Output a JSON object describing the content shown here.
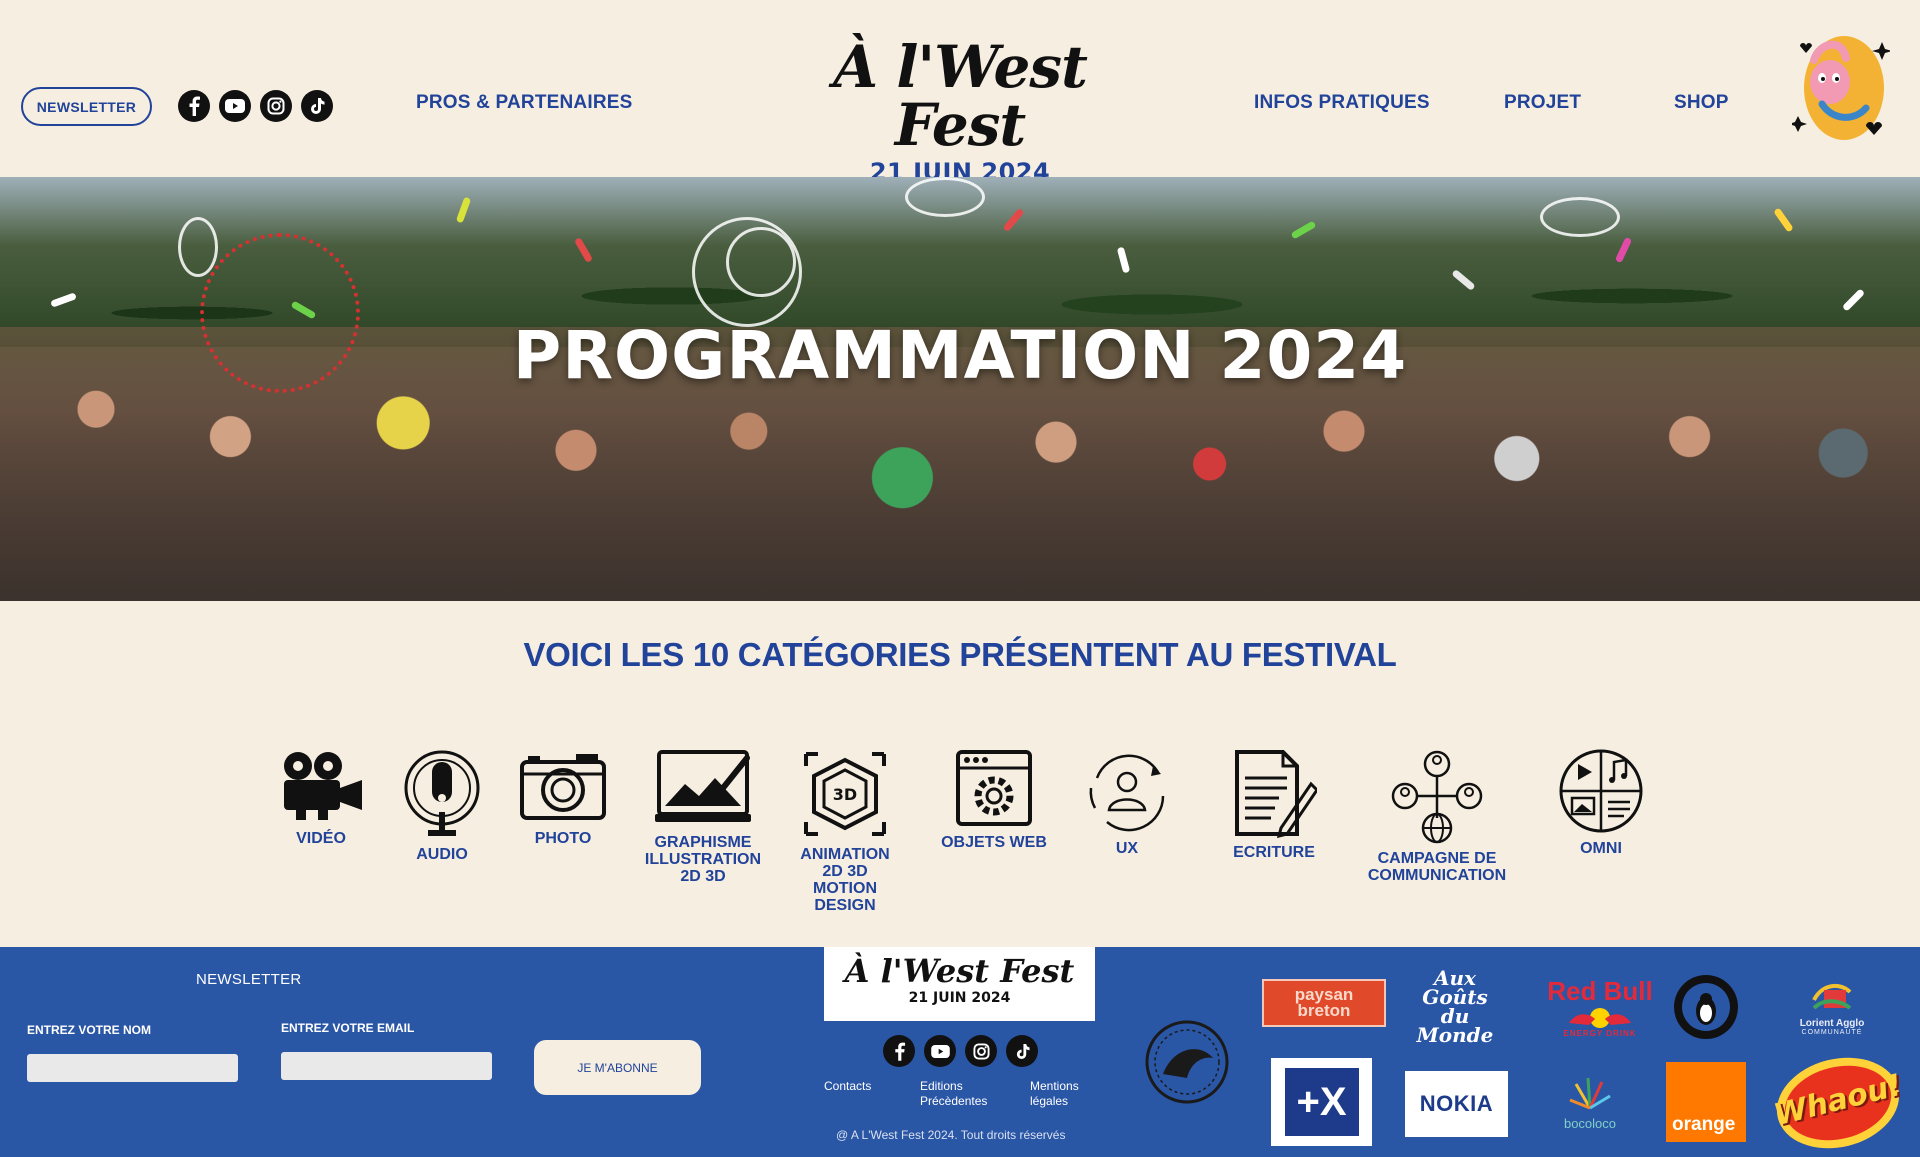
{
  "header": {
    "newsletter_label": "NEWSLETTER",
    "socials": [
      "facebook-icon",
      "youtube-icon",
      "instagram-icon",
      "tiktok-icon"
    ],
    "nav_left": "PROS & PARTENAIRES",
    "brand_title": "À l'West Fest",
    "brand_date": "21 JUIN 2024",
    "nav_right": [
      "INFOS PRATIQUES",
      "PROJET",
      "SHOP"
    ]
  },
  "hero": {
    "title": "PROGRAMMATION 2024"
  },
  "categories": {
    "heading": "VOICI LES 10 CATÉGORIES PRÉSENTENT AU FESTIVAL",
    "items": [
      {
        "label": "VIDÉO",
        "icon": "video-camera-icon"
      },
      {
        "label": "AUDIO",
        "icon": "microphone-icon"
      },
      {
        "label": "PHOTO",
        "icon": "photo-camera-icon"
      },
      {
        "label": "GRAPHISME\nILLUSTRATION\n2D 3D",
        "icon": "graphic-tablet-icon"
      },
      {
        "label": "ANIMATION\n2D 3D\nMOTION\nDESIGN",
        "icon": "3d-cube-icon"
      },
      {
        "label": "OBJETS WEB",
        "icon": "web-gear-icon"
      },
      {
        "label": "UX",
        "icon": "user-cycle-icon"
      },
      {
        "label": "ECRITURE",
        "icon": "document-pen-icon"
      },
      {
        "label": "CAMPAGNE DE\nCOMMUNICATION",
        "icon": "network-globe-icon"
      },
      {
        "label": "OMNI",
        "icon": "omni-media-icon"
      }
    ]
  },
  "footer": {
    "newsletter_title": "NEWSLETTER",
    "name_label": "ENTREZ VOTRE NOM",
    "email_label": "ENTREZ VOTRE EMAIL",
    "subscribe_label": "JE M'ABONNE",
    "brand_title": "À l'West Fest",
    "brand_date": "21 JUIN 2024",
    "links": [
      "Contacts",
      "Editions\nPrécèdentes",
      "Mentions\nlégales"
    ],
    "copyright": "@ A L'West Fest 2024. Tout droits réservés",
    "partners": {
      "paysan": "paysan\nbreton",
      "gouts": "Aux\nGoûts\ndu Monde",
      "redbull": "Red Bull",
      "redbull_sub": "ENERGY DRINK",
      "lorient": "Lorient Agglo",
      "lorient_sub": "COMMUNAUTÉ",
      "plusx": "+X",
      "nokia": "NOKIA",
      "bocoloco": "bocoloco",
      "orange": "orange",
      "whaou": "Whaou!"
    }
  },
  "colors": {
    "cream": "#f6efe1",
    "brand_blue": "#22439a",
    "footer_blue": "#2a56a6"
  }
}
